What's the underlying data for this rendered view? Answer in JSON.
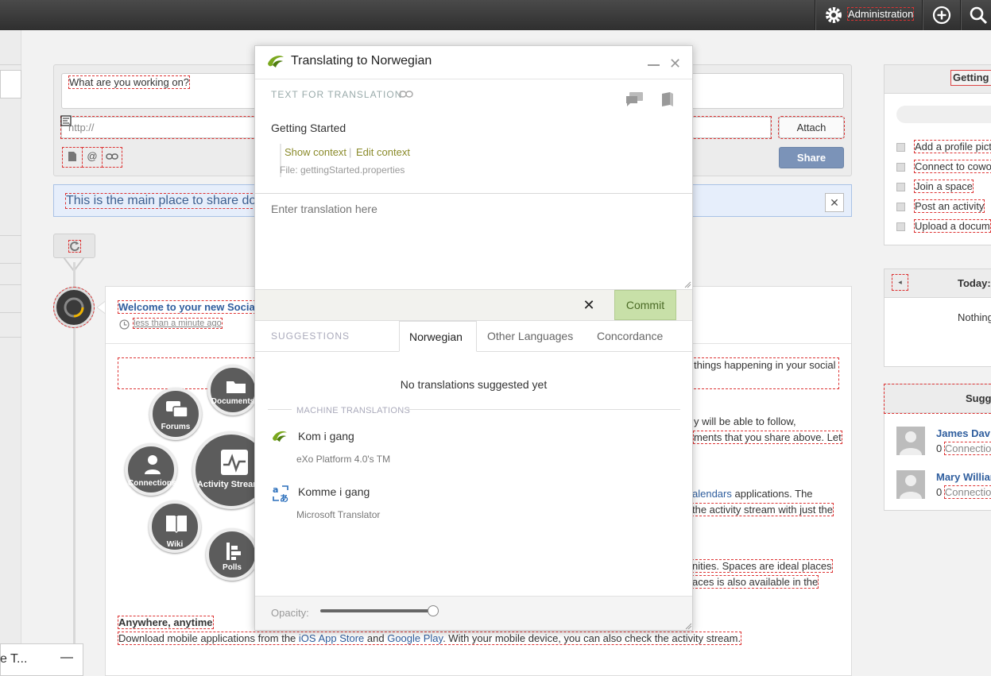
{
  "topbar": {
    "admin_label": "Administration"
  },
  "composer": {
    "what_placeholder": "What are you working on?",
    "url_placeholder": "http://",
    "attach_label": "Attach",
    "share_label": "Share",
    "mention_icon": "@"
  },
  "banner": {
    "text": "This is the main place to share do"
  },
  "activity": {
    "title": "Welcome to your new Socia",
    "time": "less than a minute ago",
    "bubbles": [
      "Documents",
      "Forums",
      "Connections",
      "Activity Streams",
      "Wiki",
      "Polls"
    ],
    "line1": "things happening in your social",
    "line2": "y will be able to follow,",
    "line3": "ments that you share above. Let",
    "line4_link": "alendars",
    "line4_rest": " applications. The",
    "line5": "the activity stream with just the",
    "line6": "nities. Spaces are ideal places",
    "line7": "aces is also available in the",
    "anywhere_heading": "Anywhere, anytime",
    "download_pre": "Download mobile applications from the ",
    "ios_link": "iOS App Store",
    "download_mid": " and ",
    "gplay_link": "Google Play",
    "download_post": ". With your mobile device, you can also check the activity stream."
  },
  "getting_started": {
    "title": "Getting",
    "items": [
      "Add a profile pict",
      "Connect to cowo",
      "Join a space",
      "Post an activity",
      "Upload a docum"
    ]
  },
  "calendar": {
    "title": "Today:",
    "empty": "Nothing"
  },
  "suggestions": {
    "title": "Sugg",
    "people": [
      {
        "name": "James Dav",
        "count": "0",
        "meta": "Connectio"
      },
      {
        "name": "Mary Willian",
        "count": "0",
        "meta": "Connectio"
      }
    ]
  },
  "chat": {
    "label": "e T..."
  },
  "dialog": {
    "title": "Translating to Norwegian",
    "text_for_translation": "TEXT FOR TRANSLATION",
    "source_text": "Getting Started",
    "show_context": "Show context",
    "separator": "|",
    "edit_context": "Edit context",
    "file": "File: gettingStarted.properties",
    "translation_placeholder": "Enter translation here",
    "commit_label": "Commit",
    "suggestions_label": "SUGGESTIONS",
    "tabs": [
      "Norwegian",
      "Other Languages",
      "Concordance"
    ],
    "no_suggestions": "No translations suggested yet",
    "machine_translations_label": "MACHINE TRANSLATIONS",
    "machine_translations": [
      {
        "text": "Kom i gang",
        "source": "eXo Platform 4.0's TM"
      },
      {
        "text": "Komme i gang",
        "source": "Microsoft Translator"
      }
    ],
    "opacity_label": "Opacity:",
    "opacity_value": 0.97
  },
  "colors": {
    "accent_green": "#8a8a2a",
    "commit_bg": "#c8e0a8",
    "link_blue": "#2f5e9e",
    "share_bg": "#7b93b8"
  }
}
